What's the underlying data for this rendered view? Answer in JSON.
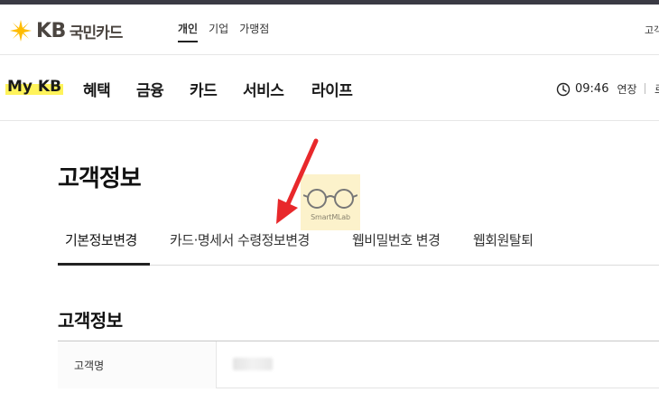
{
  "header": {
    "logo": {
      "kb": "KB",
      "name": "국민카드"
    },
    "segments": [
      "개인",
      "기업",
      "가맹점"
    ],
    "active_segment": "개인",
    "right_text": "고객"
  },
  "gnb": {
    "items": [
      "My KB",
      "혜택",
      "금융",
      "카드",
      "서비스",
      "라이프"
    ],
    "session": {
      "time": "09:46",
      "extend_label": "연장",
      "cut_text": "로"
    }
  },
  "page": {
    "title": "고객정보",
    "tabs": [
      "기본정보변경",
      "카드·명세서 수령정보변경",
      "웹비밀번호 변경",
      "웹회원탈퇴"
    ],
    "active_tab": "기본정보변경",
    "section_title": "고객정보",
    "info_rows": [
      {
        "label": "고객명",
        "value": ""
      }
    ]
  },
  "watermark": {
    "text": "SmartMLab"
  },
  "colors": {
    "brand_yellow": "#ffbc00",
    "highlight": "#fff35a",
    "arrow_red": "#e8282b"
  }
}
